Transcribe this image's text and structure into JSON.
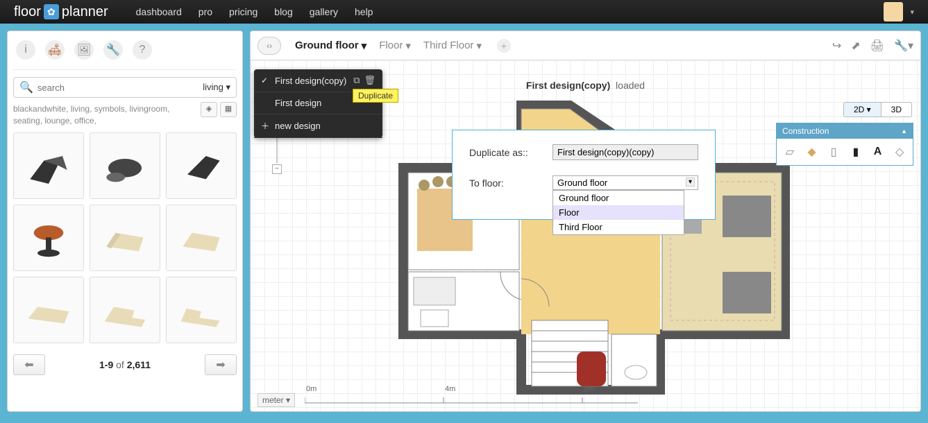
{
  "app": {
    "logo_left": "floor",
    "logo_right": "planner"
  },
  "nav": {
    "items": [
      "dashboard",
      "pro",
      "pricing",
      "blog",
      "gallery",
      "help"
    ]
  },
  "user": {
    "dropdown_caret": "▾"
  },
  "sidebar": {
    "search_placeholder": "search",
    "category": "living",
    "tags": "blackandwhite, living, symbols, livingroom, seating, lounge, office,",
    "pager": {
      "range": "1-9",
      "of_label": "of",
      "total": "2,611"
    }
  },
  "floors": {
    "tabs": [
      {
        "label": "Ground floor",
        "active": true
      },
      {
        "label": "Floor",
        "active": false
      },
      {
        "label": "Third Floor",
        "active": false
      }
    ]
  },
  "designs_menu": {
    "items": [
      {
        "label": "First design(copy)",
        "checked": true,
        "has_icons": true
      },
      {
        "label": "First design",
        "checked": false,
        "has_icons": false
      },
      {
        "label": "new design",
        "checked": false,
        "is_add": true
      }
    ],
    "tooltip": "Duplicate"
  },
  "project": {
    "title_bold": "First design(copy)",
    "title_suffix": "loaded"
  },
  "view": {
    "d2": "2D",
    "d3": "3D"
  },
  "construction": {
    "title": "Construction",
    "tools": [
      "wall-icon",
      "surface-icon",
      "door-icon",
      "window-icon",
      "text-icon",
      "dimension-icon"
    ]
  },
  "dialog": {
    "dup_label": "Duplicate as::",
    "dup_value": "First design(copy)(copy)",
    "floor_label": "To floor:",
    "floor_value": "Ground floor",
    "options": [
      "Ground floor",
      "Floor",
      "Third Floor"
    ],
    "highlighted": "Floor"
  },
  "ruler": {
    "unit": "meter",
    "marks": [
      "0m",
      "4m",
      "8m"
    ]
  }
}
